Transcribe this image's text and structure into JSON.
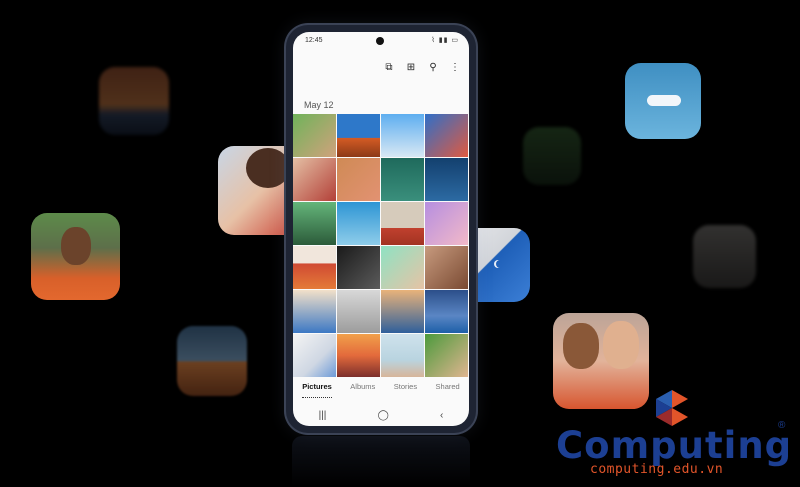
{
  "statusbar": {
    "time": "12:45",
    "system_icons": "⌇ ▮▮ ▭"
  },
  "toolbar": {
    "icons": [
      "select-icon",
      "add-icon",
      "search-icon",
      "more-icon"
    ],
    "glyphs": [
      "⧉",
      "⊞",
      "⚲",
      "⋮"
    ]
  },
  "gallery": {
    "date_label": "May 12"
  },
  "tabs": [
    {
      "label": "Pictures",
      "active": true
    },
    {
      "label": "Albums",
      "active": false
    },
    {
      "label": "Stories",
      "active": false
    },
    {
      "label": "Shared",
      "active": false
    }
  ],
  "navbar": {
    "recent": "|||",
    "home": "◯",
    "back": "‹"
  },
  "brand": {
    "name": "Computing",
    "registered": "®",
    "url": "computing.edu.vn"
  },
  "colors": {
    "brand_blue": "#1c3f93",
    "brand_orange": "#e2552a",
    "background": "#000000"
  }
}
